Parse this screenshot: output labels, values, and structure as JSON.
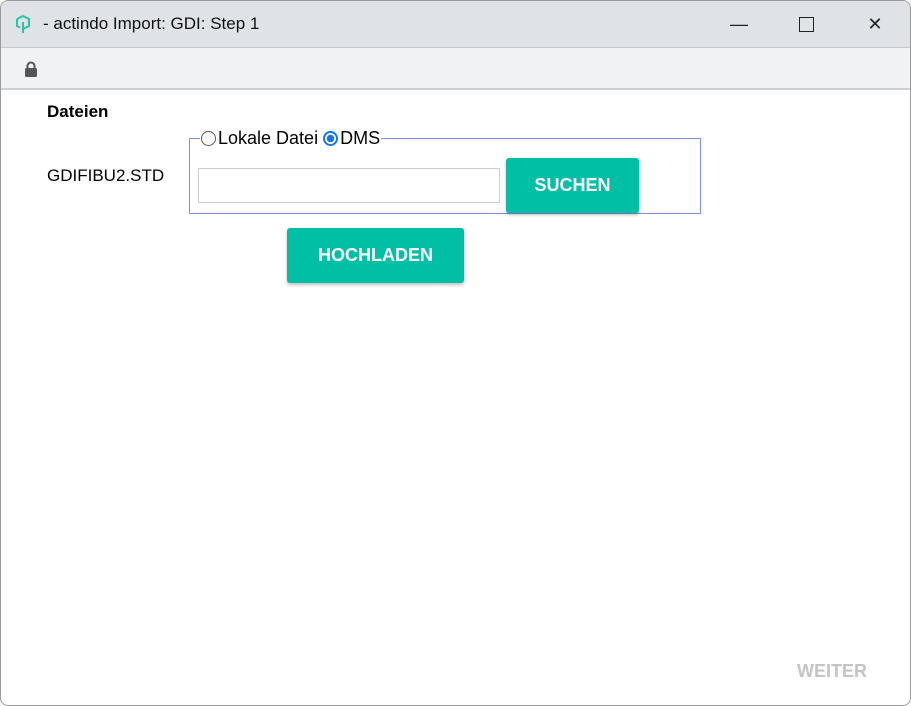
{
  "window": {
    "title": "- actindo Import: GDI: Step 1",
    "minimize_icon": "minimize-icon",
    "maximize_icon": "maximize-icon",
    "close_icon": "close-icon"
  },
  "address_bar": {
    "icon": "lock-icon"
  },
  "form": {
    "section_label": "Dateien",
    "file_name": "GDIFIBU2.STD",
    "source_options": [
      {
        "label": "Lokale Datei",
        "selected": false
      },
      {
        "label": "DMS",
        "selected": true
      }
    ],
    "path_input_value": "",
    "search_button": "SUCHEN",
    "upload_button": "HOCHLADEN"
  },
  "footer": {
    "next_button": "WEITER"
  },
  "colors": {
    "accent": "#00bfa5",
    "radio_selected": "#1a73e8"
  }
}
